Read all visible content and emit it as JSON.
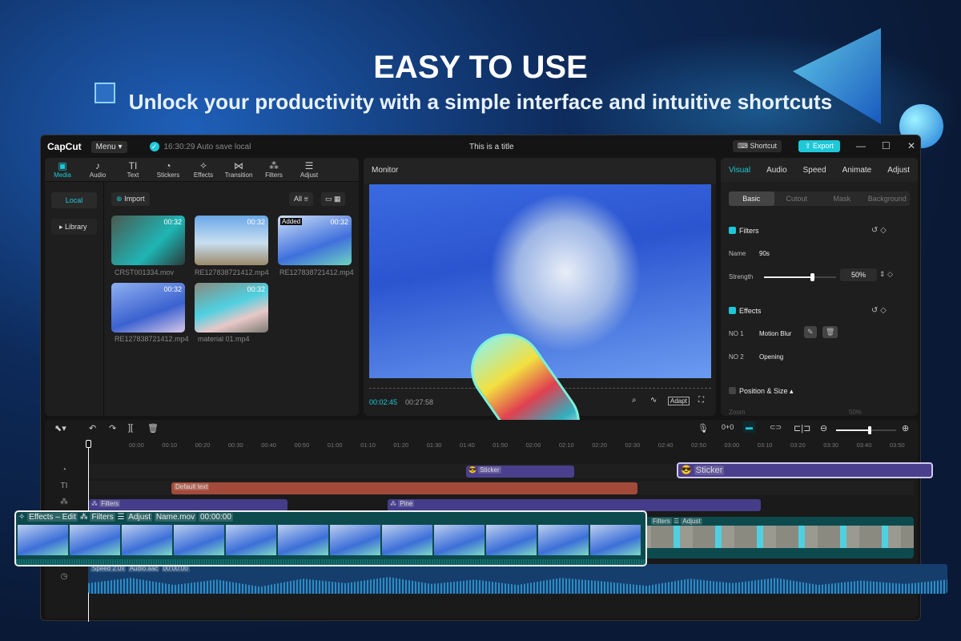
{
  "hero": {
    "title": "EASY TO USE",
    "subtitle": "Unlock your productivity with a simple interface and intuitive shortcuts"
  },
  "app": {
    "logo": "CapCut",
    "menu": "Menu",
    "autosave": "16:30:29 Auto save local",
    "title": "This is a title",
    "shortcut": "Shortcut",
    "export": "Export",
    "accent": "#1ec8d8"
  },
  "media": {
    "tabs": [
      {
        "label": "Media",
        "icon": "play-box-icon"
      },
      {
        "label": "Audio",
        "icon": "music-icon"
      },
      {
        "label": "Text",
        "icon": "text-icon"
      },
      {
        "label": "Stickers",
        "icon": "sticker-icon"
      },
      {
        "label": "Effects",
        "icon": "star-icon"
      },
      {
        "label": "Transition",
        "icon": "bowtie-icon"
      },
      {
        "label": "Filters",
        "icon": "filters-icon"
      },
      {
        "label": "Adjust",
        "icon": "sliders-icon"
      }
    ],
    "local": "Local",
    "library": "Library",
    "import": "Import",
    "filter_all": "All",
    "items": [
      {
        "name": "CRST001334.mov",
        "duration": "00:32"
      },
      {
        "name": "RE127838721412.mp4",
        "duration": "00:32"
      },
      {
        "name": "RE127838721412.mp4",
        "duration": "00:32",
        "badge": "Added"
      },
      {
        "name": "RE127838721412.mp4",
        "duration": "00:32"
      },
      {
        "name": "material 01.mp4",
        "duration": "00:32"
      }
    ]
  },
  "monitor": {
    "label": "Monitor",
    "current": "00:02:45",
    "total": "00:27:58",
    "adapt": "Adapt"
  },
  "inspector": {
    "tabs": [
      "Visual",
      "Audio",
      "Speed",
      "Animate",
      "Adjust"
    ],
    "subtabs": [
      "Basic",
      "Cutout",
      "Mask",
      "Background"
    ],
    "filters": {
      "label": "Filters",
      "name_label": "Name",
      "name": "90s",
      "strength_label": "Strength",
      "strength": "50%"
    },
    "effects": {
      "label": "Effects",
      "items": [
        {
          "no": "NO 1",
          "name": "Motion Blur"
        },
        {
          "no": "NO 2",
          "name": "Opening"
        }
      ]
    },
    "position": {
      "label": "Position & Size",
      "zoom_label": "Zoom",
      "zoom": "50%"
    }
  },
  "timeline": {
    "ticks": [
      "00:00",
      "00:10",
      "00:20",
      "00:30",
      "00:40",
      "00:50",
      "01:00",
      "01:10",
      "01:20",
      "01:30",
      "01:40",
      "01:50",
      "02:00",
      "02:10",
      "02:20",
      "02:30",
      "02:40",
      "02:50",
      "03:00",
      "03:10",
      "03:20",
      "03:30",
      "03:40",
      "03:50"
    ],
    "sticker1": "Sticker",
    "sticker2": "Sticker",
    "text_clip": "Default text",
    "filter1": "Filters",
    "filter2": "Pine",
    "main": {
      "effects": "Effects – Edit",
      "filters": "Filters",
      "adjust": "Adjust",
      "name": "Name.mov",
      "time": "00:00:00"
    },
    "second": {
      "filters": "Filters",
      "adjust": "Adjust"
    },
    "audio": {
      "speed": "Speed 2.0x",
      "name": "Audio.aac",
      "time": "00:00:00"
    }
  }
}
